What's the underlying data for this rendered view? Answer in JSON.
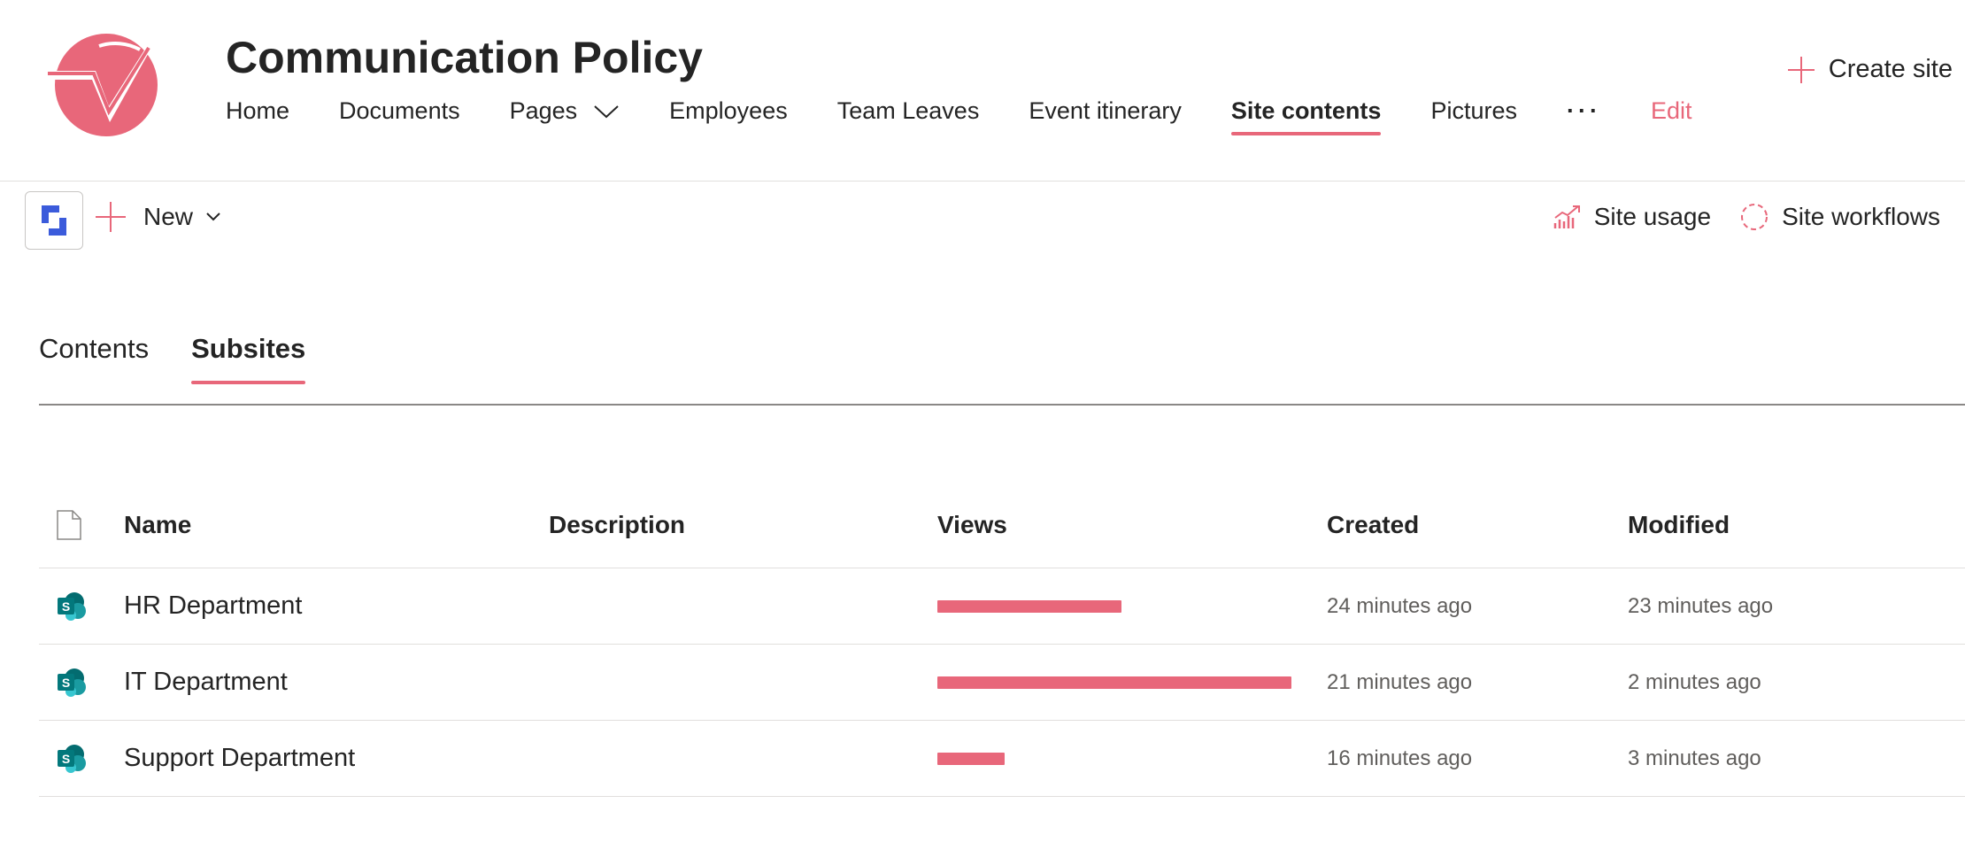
{
  "site": {
    "title": "Communication Policy",
    "create_site_label": "Create site",
    "accent_color": "#e8677a"
  },
  "nav": {
    "items": [
      {
        "label": "Home"
      },
      {
        "label": "Documents"
      },
      {
        "label": "Pages",
        "has_dropdown": true
      },
      {
        "label": "Employees"
      },
      {
        "label": "Team Leaves"
      },
      {
        "label": "Event itinerary"
      },
      {
        "label": "Site contents",
        "active": true
      },
      {
        "label": "Pictures"
      },
      {
        "label": "···"
      },
      {
        "label": "Edit"
      }
    ]
  },
  "command_bar": {
    "new_label": "New",
    "site_usage_label": "Site usage",
    "site_workflows_label": "Site workflows"
  },
  "tabs": {
    "items": [
      {
        "label": "Contents"
      },
      {
        "label": "Subsites",
        "active": true
      }
    ]
  },
  "table": {
    "columns": {
      "name": "Name",
      "description": "Description",
      "views": "Views",
      "created": "Created",
      "modified": "Modified"
    },
    "rows": [
      {
        "name": "HR Department",
        "description": "",
        "views_fraction": 0.52,
        "created": "24 minutes ago",
        "modified": "23 minutes ago"
      },
      {
        "name": "IT Department",
        "description": "",
        "views_fraction": 1.0,
        "created": "21 minutes ago",
        "modified": "2 minutes ago"
      },
      {
        "name": "Support Department",
        "description": "",
        "views_fraction": 0.19,
        "created": "16 minutes ago",
        "modified": "3 minutes ago"
      }
    ]
  }
}
